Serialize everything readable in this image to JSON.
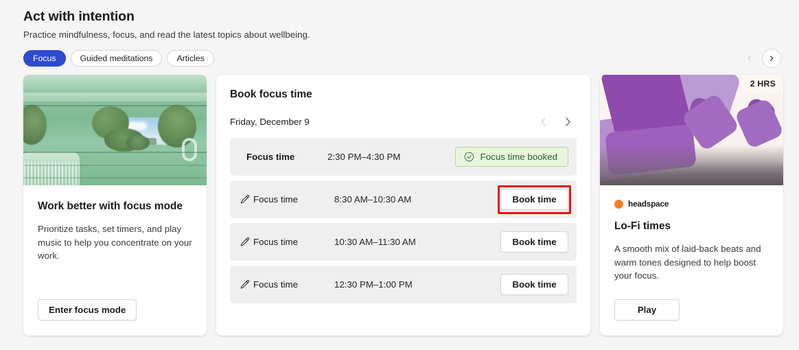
{
  "header": {
    "title": "Act with intention",
    "subtitle": "Practice mindfulness, focus, and read the latest topics about wellbeing."
  },
  "filter_pills": [
    {
      "label": "Focus",
      "selected": true
    },
    {
      "label": "Guided meditations",
      "selected": false
    },
    {
      "label": "Articles",
      "selected": false
    }
  ],
  "carousel": {
    "prev_icon": "chevron-left-icon",
    "next_icon": "chevron-right-icon",
    "prev_enabled": false,
    "next_enabled": true
  },
  "focus_card": {
    "image_alt": "green-room-with-plants-image",
    "heading": "Work better with focus mode",
    "body": "Prioritize tasks, set timers, and play music to help you concentrate on your work.",
    "button_label": "Enter focus mode"
  },
  "book_card": {
    "title": "Book focus time",
    "date_label": "Friday, December 9",
    "prev_day_icon": "chevron-left-icon",
    "next_day_icon": "chevron-right-icon",
    "slots": [
      {
        "name": "Focus time",
        "time": "2:30 PM–4:30 PM",
        "state": "booked",
        "badge_label": "Focus time booked",
        "badge_icon": "check-circle-icon",
        "edit_icon": null,
        "highlighted": false
      },
      {
        "name": "Focus time",
        "time": "8:30 AM–10:30 AM",
        "state": "available",
        "button_label": "Book time",
        "edit_icon": "pencil-icon",
        "highlighted": true
      },
      {
        "name": "Focus time",
        "time": "10:30 AM–11:30 AM",
        "state": "available",
        "button_label": "Book time",
        "edit_icon": "pencil-icon",
        "highlighted": false
      },
      {
        "name": "Focus time",
        "time": "12:30 PM–1:00 PM",
        "state": "available",
        "button_label": "Book time",
        "edit_icon": "pencil-icon",
        "highlighted": false
      }
    ]
  },
  "media_card": {
    "image_alt": "purple-rotated-squares-image",
    "duration_badge": "2 HRS",
    "brand": "headspace",
    "brand_icon": "orange-circle-icon",
    "heading": "Lo-Fi times",
    "body": "A smooth mix of laid-back beats and warm tones designed to help boost your focus.",
    "button_label": "Play"
  },
  "colors": {
    "page_background": "#f5f5f5",
    "accent_blue": "#2f4ad0",
    "badge_green_bg": "#e9f4dd",
    "badge_green_text": "#24632f",
    "highlight_red": "#ee1111",
    "brand_orange": "#ff7b23"
  }
}
